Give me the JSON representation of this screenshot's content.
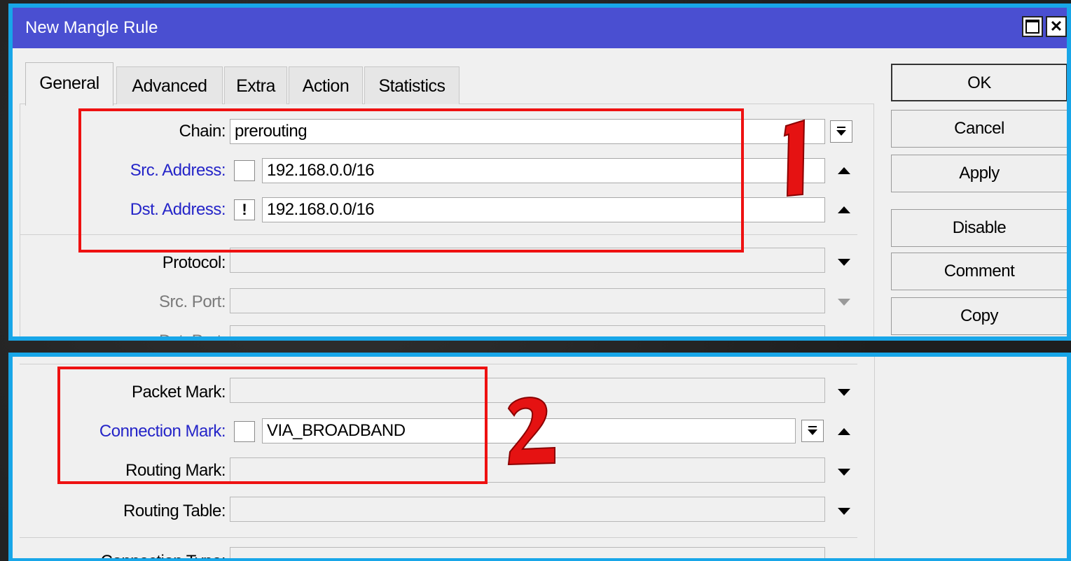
{
  "window": {
    "title": "New Mangle Rule"
  },
  "tabs": [
    {
      "label": "General",
      "active": true
    },
    {
      "label": "Advanced",
      "active": false
    },
    {
      "label": "Extra",
      "active": false
    },
    {
      "label": "Action",
      "active": false
    },
    {
      "label": "Statistics",
      "active": false
    }
  ],
  "general": {
    "chain": {
      "label": "Chain:",
      "value": "prerouting"
    },
    "src_address": {
      "label": "Src. Address:",
      "value": "192.168.0.0/16",
      "invert": false
    },
    "dst_address": {
      "label": "Dst. Address:",
      "value": "192.168.0.0/16",
      "invert": true
    },
    "protocol": {
      "label": "Protocol:",
      "value": ""
    },
    "src_port": {
      "label": "Src. Port:",
      "value": ""
    },
    "dst_port": {
      "label": "Dst. Port:",
      "value": ""
    }
  },
  "marks": {
    "packet_mark": {
      "label": "Packet Mark:",
      "value": ""
    },
    "connection_mark": {
      "label": "Connection Mark:",
      "value": "VIA_BROADBAND",
      "invert": false
    },
    "routing_mark": {
      "label": "Routing Mark:",
      "value": ""
    },
    "routing_table": {
      "label": "Routing Table:",
      "value": ""
    },
    "connection_type": {
      "label": "Connection Type:",
      "value": ""
    }
  },
  "buttons": {
    "ok": "OK",
    "cancel": "Cancel",
    "apply": "Apply",
    "disable": "Disable",
    "comment": "Comment",
    "copy": "Copy"
  },
  "annotations": {
    "box1_number": "1",
    "box2_number": "2"
  },
  "colors": {
    "frame_border": "#18a6e8",
    "titlebar": "#4a4fd1",
    "annotation_red": "#ee1111",
    "link_label_blue": "#2525c8"
  }
}
